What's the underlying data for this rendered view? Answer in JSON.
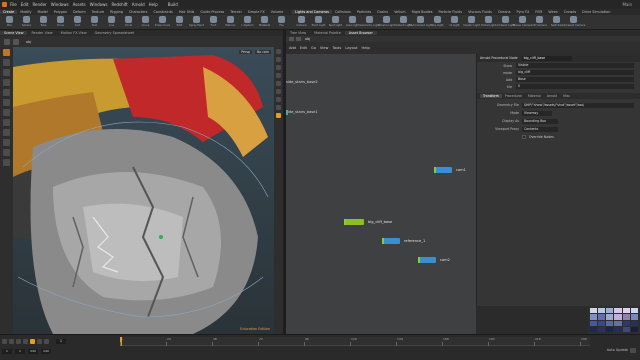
{
  "menubar": {
    "items": [
      "File",
      "Edit",
      "Render",
      "Windows",
      "Assets",
      "Windows",
      "Redshift",
      "Arnold",
      "Help"
    ],
    "build": "Build",
    "window_title": "Main"
  },
  "shelf_left": {
    "tabs": [
      "Create",
      "Modify",
      "Model",
      "Polygon",
      "Deform",
      "Texture",
      "Rigging",
      "Characters",
      "Constraints",
      "Hair Utils",
      "Guide Process",
      "Terrain",
      "Simple FX",
      "Volume"
    ],
    "tools": [
      "Box",
      "Sphere",
      "Tube",
      "Torus",
      "Grid",
      "Null",
      "Line",
      "Circle",
      "Curve",
      "Draw Curve",
      "Path",
      "Spray Paint",
      "Font",
      "Platonic",
      "L-System",
      "Metaball",
      "File"
    ]
  },
  "shelf_right": {
    "tabs": [
      "Lights and Cameras",
      "Collisions",
      "Particles",
      "Grains",
      "Vellum",
      "Rigid Bodies",
      "Particle Fluids",
      "Viscous Fluids",
      "Oceans",
      "Pyro FX",
      "FEM",
      "Wires",
      "Crowds",
      "Drive Simulation"
    ],
    "tools": [
      "Camera",
      "Point Light",
      "Spot Light",
      "Area Light",
      "Geometry Light",
      "Volume Light",
      "Distant Light",
      "Environment Light",
      "Sky Light",
      "GI Light",
      "Caustic Light",
      "Portal Light",
      "Ambient Light",
      "Stereo Camera",
      "VR Camera",
      "Switcher",
      "Gamepad Camera"
    ]
  },
  "left_pane": {
    "tabs": [
      "Scene View",
      "Render View",
      "Motion FX View",
      "Geometry Spreadsheet"
    ],
    "path": "obj",
    "persp_label": "Persp",
    "cam_label": "No cam",
    "edu_label": "Education Edition"
  },
  "network": {
    "tabs": [
      "Tree View",
      "Material Palette",
      "Asset Browser"
    ],
    "path": "obj",
    "menu": [
      "Add",
      "Edit",
      "Go",
      "View",
      "Tools",
      "Layout",
      "Help"
    ],
    "labels": {
      "side_stairs_base2": "side_stairs_base2",
      "side_stairs_base1": "side_stairs_base1"
    },
    "nodes": [
      {
        "id": "cam1",
        "label": "cam1",
        "color": "#3a8fd0",
        "cap": "#7fd040"
      },
      {
        "id": "big_cliff_base",
        "label": "big_cliff_base",
        "color": "#8cc020",
        "cap": "#7fd040"
      },
      {
        "id": "reference_1",
        "label": "reference_1",
        "color": "#3a8fd0",
        "cap": "#7fd040"
      },
      {
        "id": "cam2",
        "label": "cam2",
        "color": "#3a8fd0",
        "cap": "#7fd040"
      }
    ]
  },
  "params": {
    "node_type": "Arnold Procedural Node",
    "node_name": "big_cliff_base",
    "rows": [
      {
        "label": "Show",
        "value": "Visible"
      },
      {
        "label": "mode",
        "value": "big_cliff"
      },
      {
        "label": "Add",
        "value": "Base"
      },
      {
        "label": "tile",
        "value": "0"
      }
    ],
    "tabs": [
      "Transform",
      "Procedural",
      "Material",
      "Arnold",
      "Misc"
    ],
    "fields": {
      "geometry_file_label": "Geometry File",
      "geometry_file_value": "$HIP/\"show\"/assets/\"shot\"/asset\"/ass/",
      "mode_label": "Mode",
      "mode_value": "Viewmsy",
      "display_as_label": "Display As",
      "display_as_value": "Bounding Box",
      "viewport_proxy_label": "Viewport Proxy",
      "viewport_proxy_value": "Contents",
      "override_label": "Override Nodes"
    }
  },
  "swatch_colors": [
    "#cfd8e8",
    "#b8c8e0",
    "#9ab0d8",
    "#d8c8e8",
    "#e0d0f0",
    "#c8d8f0",
    "#8090c0",
    "#6070a8",
    "#a0a8d0",
    "#c0b0e0",
    "#9080b0",
    "#7888b8",
    "#4858a0",
    "#38488a",
    "#5868a8",
    "#6870a0",
    "#303870",
    "#283060",
    "#202850",
    "#303060",
    "#1c2448",
    "#242c58",
    "#404878",
    "#181e3c"
  ],
  "timeline": {
    "current_frame": "1",
    "tick_labels": [
      "1",
      "24",
      "48",
      "72",
      "96",
      "120",
      "144",
      "168",
      "192",
      "216",
      "240"
    ],
    "range": [
      "1",
      "1",
      "240",
      "240"
    ],
    "auto_update": "Auto Update"
  },
  "colors": {
    "node_blue": "#3a8fd0",
    "node_green": "#8cc020",
    "timeline_accent": "#e0a020",
    "edu_orange": "#e8a040"
  }
}
